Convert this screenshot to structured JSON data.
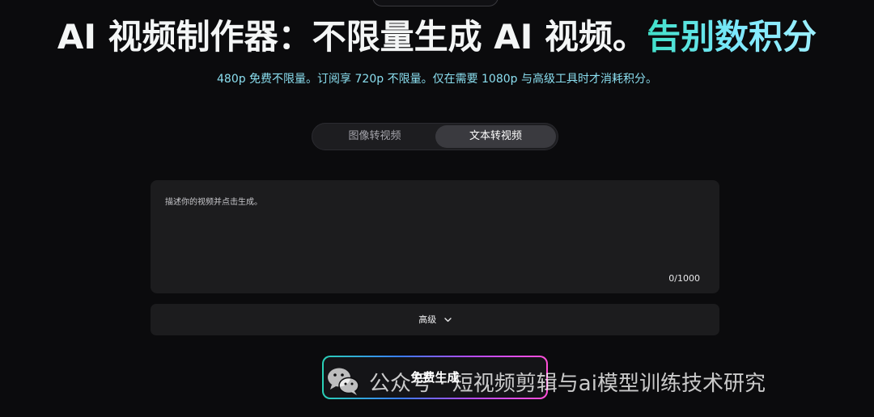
{
  "top_pill": {
    "label": "···"
  },
  "header": {
    "title_part1": "AI 视频制作器：不限量生成 AI 视频。",
    "title_part2": "告别数积分",
    "subtitle": "480p 免费不限量。订阅享 720p 不限量。仅在需要 1080p 与高级工具时才消耗积分。"
  },
  "tabs": [
    {
      "label": "图像转视频",
      "active": false
    },
    {
      "label": "文本转视频",
      "active": true
    }
  ],
  "prompt": {
    "placeholder": "描述你的视频并点击生成。",
    "value": "",
    "counter": "0/1000"
  },
  "advanced": {
    "label": "高级",
    "icon": "chevron-down-icon"
  },
  "generate": {
    "label": "免费生成"
  },
  "watermark": {
    "icon": "wechat-icon",
    "text": "公众号 · 短视频剪辑与ai模型训练技术研究"
  },
  "colors": {
    "background": "#0b0b0d",
    "accent_teal": "#3fe0c8",
    "accent_cyan": "#8bdff0",
    "panel": "#1c1c1e"
  }
}
